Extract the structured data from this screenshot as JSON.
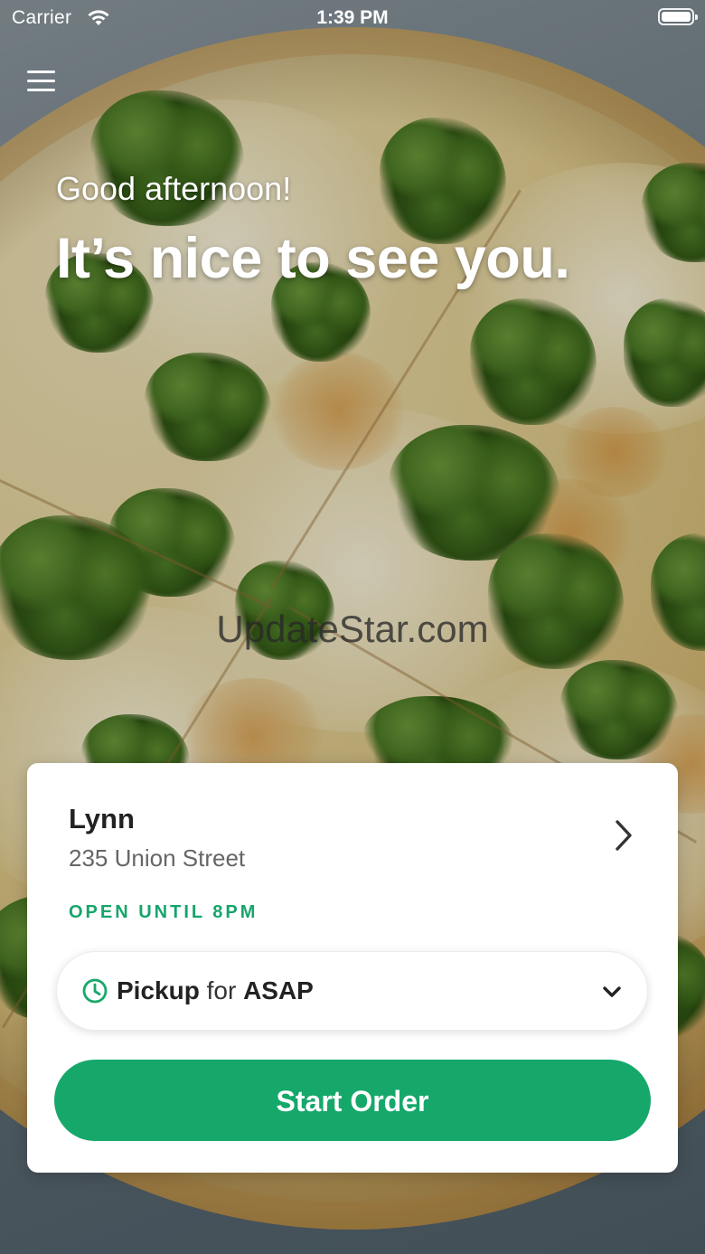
{
  "status_bar": {
    "carrier": "Carrier",
    "time": "1:39 PM",
    "wifi_icon": "wifi-icon",
    "battery_icon": "battery-icon"
  },
  "header": {
    "menu_icon": "hamburger-menu-icon",
    "greeting": "Good afternoon!",
    "headline": "It’s nice to see you."
  },
  "watermark": "UpdateStar.com",
  "location_card": {
    "name": "Lynn",
    "address": "235 Union Street",
    "hours_status": "OPEN UNTIL 8PM",
    "chevron_icon": "chevron-right-icon",
    "order_type": {
      "icon": "clock-icon",
      "method": "Pickup",
      "connector": "for",
      "time": "ASAP",
      "dropdown_icon": "chevron-down-icon"
    },
    "cta_label": "Start Order"
  },
  "colors": {
    "accent": "#16a86b",
    "open_status": "#16a56b",
    "card_bg": "#ffffff"
  }
}
